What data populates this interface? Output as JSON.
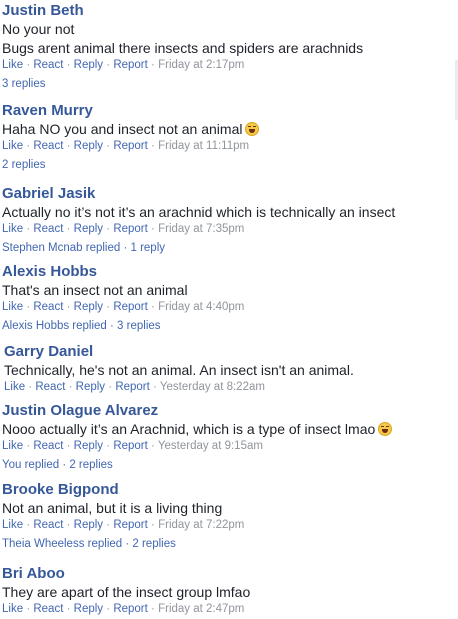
{
  "actions": {
    "like": "Like",
    "react": "React",
    "reply": "Reply",
    "report": "Report",
    "separator": "·"
  },
  "comments": [
    {
      "author": "Justin Beth",
      "lines": [
        "No your not",
        "Bugs arent animal there insects and spiders are arachnids"
      ],
      "time": "Friday at 2:17pm",
      "replies": "3 replies"
    },
    {
      "author": "Raven Murry",
      "lines": [
        "Haha NO you and insect not an animal"
      ],
      "emoji": "grinning-emoji",
      "time": "Friday at 11:11pm",
      "replies": "2 replies"
    },
    {
      "author": "Gabriel Jasik",
      "lines": [
        "Actually no it’s not it’s an arachnid which is technically an insect"
      ],
      "time": "Friday at 7:35pm",
      "replies": "Stephen Mcnab replied · 1 reply"
    },
    {
      "author": "Alexis Hobbs",
      "lines": [
        "That's an insect not an animal"
      ],
      "time": "Friday at 4:40pm",
      "replies": "Alexis Hobbs replied · 3 replies"
    },
    {
      "author": "Garry Daniel",
      "lines": [
        "Technically, he's not an animal. An insect isn't an animal."
      ],
      "time": "Yesterday at 8:22am",
      "replies": ""
    },
    {
      "author": "Justin Olague Alvarez",
      "lines": [
        "Nooo actually it’s an Arachnid, which is a type of insect lmao"
      ],
      "emoji": "grinning-emoji",
      "time": "Yesterday at 9:15am",
      "replies": "You replied · 2 replies"
    },
    {
      "author": "Brooke Bigpond",
      "lines": [
        "Not an animal, but it is a living thing"
      ],
      "time": "Friday at 7:22pm",
      "replies": "Theia Wheeless replied · 2 replies"
    },
    {
      "author": "Bri Aboo",
      "lines": [
        "They are apart of the insect group lmfao"
      ],
      "time": "Friday at 2:47pm",
      "replies": ""
    }
  ]
}
